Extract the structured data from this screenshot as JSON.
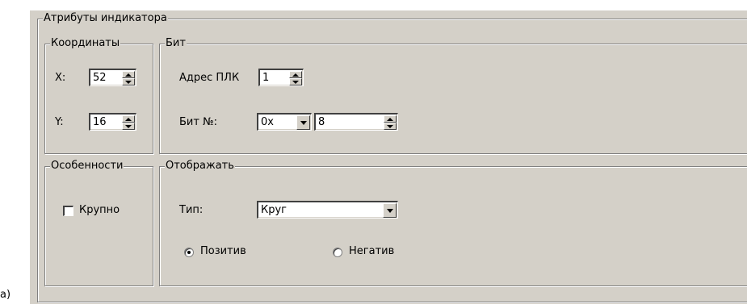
{
  "caption": "a)",
  "group_main": {
    "label": "Атрибуты индикатора"
  },
  "coords": {
    "label": "Координаты",
    "x_label": "X:",
    "x_value": "52",
    "y_label": "Y:",
    "y_value": "16"
  },
  "bit": {
    "label": "Бит",
    "plc_address_label": "Адрес ПЛК",
    "plc_address_value": "1",
    "bit_no_label": "Бит №:",
    "prefix_value": "0x",
    "bit_value": "8"
  },
  "features": {
    "label": "Особенности",
    "large_label": "Крупно",
    "large_checked": false
  },
  "display": {
    "label": "Отображать",
    "type_label": "Тип:",
    "type_value": "Круг",
    "positive_label": "Позитив",
    "negative_label": "Негатив",
    "selected": "Позитив"
  }
}
